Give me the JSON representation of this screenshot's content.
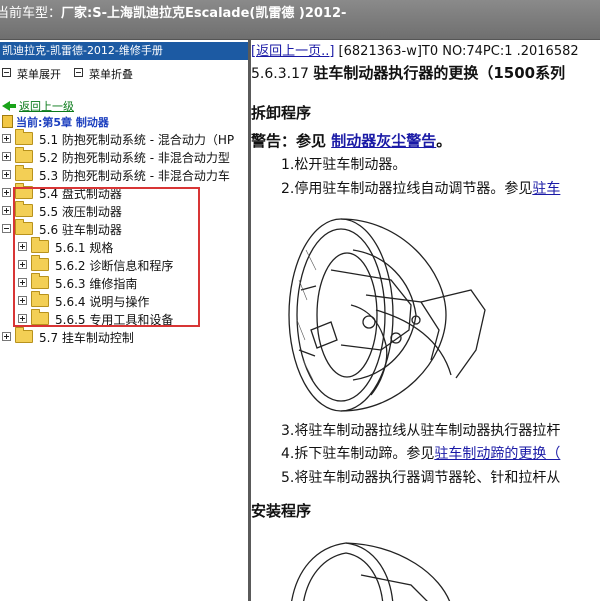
{
  "topbar": {
    "label": "当前车型：",
    "value": "厂家:S-上海凯迪拉克Escalade(凯雷德 )2012-"
  },
  "sidebar": {
    "title": "凯迪拉克-凯雷德-2012-维修手册",
    "expand_label": "菜单展开",
    "collapse_label": "菜单折叠",
    "back_label": "返回上一级",
    "current_label": "当前:第5章 制动器",
    "tree": [
      {
        "text": "5.1 防抱死制动系统 - 混合动力（HP"
      },
      {
        "text": "5.2 防抱死制动系统 - 非混合动力型"
      },
      {
        "text": "5.3 防抱死制动系统 - 非混合动力车"
      },
      {
        "text": "5.4 盘式制动器"
      },
      {
        "text": "5.5 液压制动器"
      },
      {
        "text": "5.6 驻车制动器"
      },
      {
        "text": "5.6.1 规格"
      },
      {
        "text": "5.6.2 诊断信息和程序"
      },
      {
        "text": "5.6.3 维修指南"
      },
      {
        "text": "5.6.4 说明与操作"
      },
      {
        "text": "5.6.5 专用工具和设备"
      },
      {
        "text": "5.7 挂车制动控制"
      }
    ]
  },
  "content": {
    "back_link": "[返回上一页..]",
    "doc_info": " [6821363-w]T0 NO:74PC:1 .2016582",
    "section_number": "5.6.3.17 ",
    "section_title": "驻车制动器执行器的更换（1500系列",
    "removal_heading": "拆卸程序",
    "warning_prefix": "警告：参见 ",
    "warning_link": "制动器灰尘警告",
    "warning_suffix": "。",
    "step1": "1.松开驻车制动器。",
    "step2_text": "2.停用驻车制动器拉线自动调节器。参见",
    "step2_link": "驻车",
    "step3": "3.将驻车制动器拉线从驻车制动器执行器拉杆",
    "step4_text": "4.拆下驻车制动蹄。参见",
    "step4_link": "驻车制动蹄的更换（",
    "step5": "5.将驻车制动器执行器调节器轮、针和拉杆从",
    "install_heading": "安装程序"
  }
}
